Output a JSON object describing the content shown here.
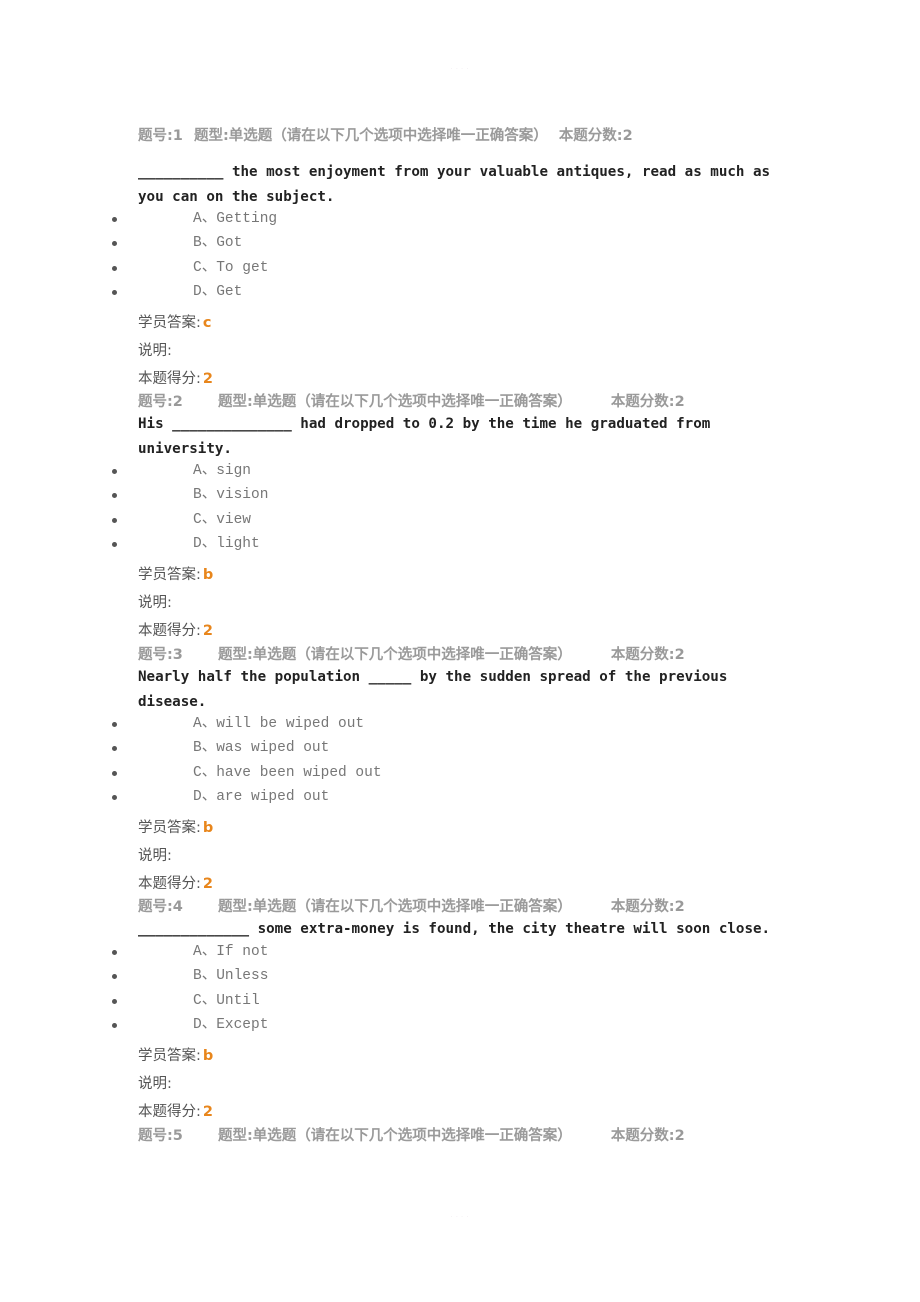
{
  "page_marks": {
    "top": "· · · ·",
    "bottom": "· · · ·"
  },
  "labels": {
    "student_answer": "学员答案:",
    "explanation": "说明:",
    "score_obtained": "本题得分:"
  },
  "questions": [
    {
      "number": "题号:1",
      "type": "题型:单选题（请在以下几个选项中选择唯一正确答案）",
      "score": "本题分数:2",
      "stem": "__________ the most enjoyment from your valuable antiques, read as much as you can on the subject.",
      "options": [
        "A、Getting",
        "B、Got",
        "C、To get",
        "D、Get"
      ],
      "student_answer": "c",
      "explanation": "",
      "score_obtained": "2"
    },
    {
      "number": "题号:2",
      "type": "题型:单选题（请在以下几个选项中选择唯一正确答案）",
      "score": "本题分数:2",
      "stem": "His ______________ had dropped to 0.2 by the time he graduated from university.",
      "options": [
        "A、sign",
        "B、vision",
        "C、view",
        "D、light"
      ],
      "student_answer": "b",
      "explanation": "",
      "score_obtained": "2"
    },
    {
      "number": "题号:3",
      "type": "题型:单选题（请在以下几个选项中选择唯一正确答案）",
      "score": "本题分数:2",
      "stem": "Nearly half the population _____ by the sudden spread of the previous disease.",
      "options": [
        "A、will be wiped out",
        "B、was wiped out",
        "C、have been wiped out",
        "D、are wiped out"
      ],
      "student_answer": "b",
      "explanation": "",
      "score_obtained": "2"
    },
    {
      "number": "题号:4",
      "type": "题型:单选题（请在以下几个选项中选择唯一正确答案）",
      "score": "本题分数:2",
      "stem": "_____________ some extra-money is found, the city theatre will soon close.",
      "options": [
        "A、If not",
        "B、Unless",
        "C、Until",
        "D、Except"
      ],
      "student_answer": "b",
      "explanation": "",
      "score_obtained": "2"
    },
    {
      "number": "题号:5",
      "type": "题型:单选题（请在以下几个选项中选择唯一正确答案）",
      "score": "本题分数:2"
    }
  ]
}
